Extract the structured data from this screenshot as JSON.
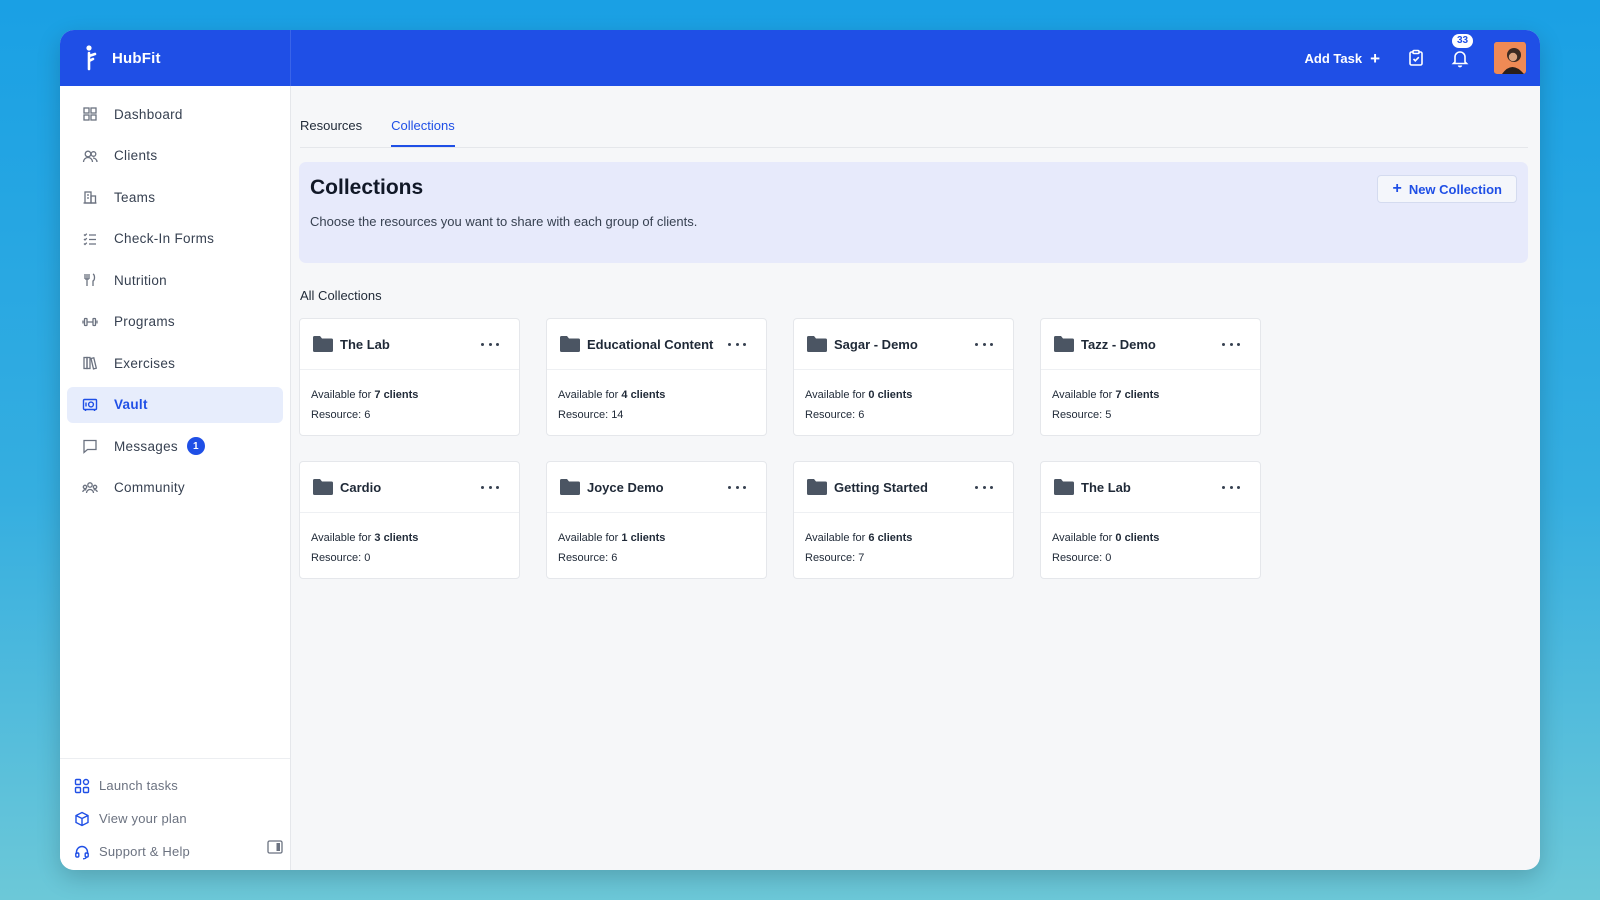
{
  "app": {
    "name": "HubFit"
  },
  "topbar": {
    "add_task_label": "Add Task",
    "add_task_icon": "plus-icon",
    "notification_count": "33",
    "icons": [
      "clipboard-check-icon",
      "bell-icon"
    ]
  },
  "sidebar": {
    "items": [
      {
        "label": "Dashboard",
        "icon": "dashboard-grid-icon"
      },
      {
        "label": "Clients",
        "icon": "users-icon"
      },
      {
        "label": "Teams",
        "icon": "building-icon"
      },
      {
        "label": "Check-In Forms",
        "icon": "checklist-icon"
      },
      {
        "label": "Nutrition",
        "icon": "utensils-icon"
      },
      {
        "label": "Programs",
        "icon": "dumbbell-icon"
      },
      {
        "label": "Exercises",
        "icon": "books-icon"
      },
      {
        "label": "Vault",
        "icon": "vault-icon",
        "active": true
      },
      {
        "label": "Messages",
        "icon": "message-icon",
        "badge": "1"
      },
      {
        "label": "Community",
        "icon": "community-icon"
      }
    ],
    "bottom": [
      {
        "label": "Launch tasks",
        "icon": "apps-icon"
      },
      {
        "label": "View your plan",
        "icon": "cube-icon"
      },
      {
        "label": "Support & Help",
        "icon": "headset-icon"
      }
    ]
  },
  "tabs": [
    {
      "label": "Resources",
      "active": false
    },
    {
      "label": "Collections",
      "active": true
    }
  ],
  "banner": {
    "title": "Collections",
    "description": "Choose the resources you want to share with each group of clients.",
    "new_button_label": "New Collection"
  },
  "section_title": "All Collections",
  "collections": [
    {
      "name": "The Lab",
      "available_prefix": "Available for ",
      "clients": "7 clients",
      "resource": "Resource: 6"
    },
    {
      "name": "Educational Content",
      "available_prefix": "Available for ",
      "clients": "4 clients",
      "resource": "Resource: 14"
    },
    {
      "name": "Sagar - Demo",
      "available_prefix": "Available for ",
      "clients": "0 clients",
      "resource": "Resource: 6"
    },
    {
      "name": "Tazz - Demo",
      "available_prefix": "Available for ",
      "clients": "7 clients",
      "resource": "Resource: 5"
    },
    {
      "name": "Cardio",
      "available_prefix": "Available for ",
      "clients": "3 clients",
      "resource": "Resource: 0"
    },
    {
      "name": "Joyce Demo",
      "available_prefix": "Available for ",
      "clients": "1 clients",
      "resource": "Resource: 6"
    },
    {
      "name": "Getting Started",
      "available_prefix": "Available for ",
      "clients": "6 clients",
      "resource": "Resource: 7"
    },
    {
      "name": "The Lab",
      "available_prefix": "Available for ",
      "clients": "0 clients",
      "resource": "Resource: 0"
    }
  ],
  "colors": {
    "brand": "#1f4fe6",
    "active_nav_bg": "#e7edfc",
    "banner_bg": "#e7eafb",
    "page_bg": "#f6f7f9"
  }
}
